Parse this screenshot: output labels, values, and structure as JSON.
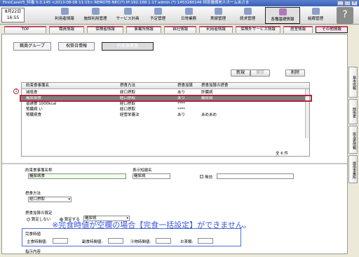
{
  "titlebar": {
    "text": "FirstCareV5_特養 5.0.145 <2013-08-08 11:15> REMOTE-NEC(*) IP:192.168.1.17 admin (*) 1453280146 特別養護老人ホームあさま"
  },
  "datebox": {
    "line1": "8月22日",
    "line2": "16:55"
  },
  "toolbar": {
    "items": [
      {
        "label": "利用者情報",
        "icon": "person-icon"
      },
      {
        "label": "施設利用管理",
        "icon": "building-icon"
      },
      {
        "label": "サービス計画",
        "icon": "plan-icon"
      },
      {
        "label": "予定管理",
        "icon": "calendar-icon"
      },
      {
        "label": "日常業務",
        "icon": "clipboard-icon"
      },
      {
        "label": "実績管理",
        "icon": "chart-icon"
      },
      {
        "label": "請求管理",
        "icon": "invoice-icon"
      },
      {
        "label": "各種基礎情報",
        "icon": "gear-icon",
        "selected": true
      },
      {
        "label": "組織管理",
        "icon": "wrench-icon"
      }
    ],
    "help": "?"
  },
  "tabs": [
    "TOP",
    "職員情報",
    "保険者情報",
    "事業所情報",
    "自社情報",
    "利用者情報",
    "保険外サービス情報",
    "居室情報",
    "その他情報"
  ],
  "side_tabs": [
    "基本情報",
    "関係者",
    "担当者情報",
    "提供事業所"
  ],
  "subtabs": [
    "職員グループ",
    "祝祭日情報",
    "約束食事箋"
  ],
  "buttons": {
    "new": "新規",
    "save": "保存",
    "delete": "削除"
  },
  "table": {
    "headers": [
      "約束食事箋名",
      "摂食方法",
      "摂食加算",
      "摂食加算の摂食"
    ],
    "rows": [
      [
        "減塩食",
        "経口摂取",
        "あり",
        "肝臓病"
      ],
      [
        "糖尿病食",
        "経口摂取",
        "あり",
        "糖尿病"
      ],
      [
        "普通食 1000kcal",
        "経口摂取",
        "****",
        ""
      ],
      [
        "腎臓病 い",
        "経口摂取",
        "****",
        ""
      ],
      [
        "腎臓病食",
        "経管栄養法",
        "あり",
        "あめあめ"
      ]
    ],
    "selected_row": 1,
    "count": "全 6 件"
  },
  "marker": "1",
  "form": {
    "name_label": "約束食事箋名称",
    "name_value": "糖尿病食",
    "short_label": "表示短縮名",
    "short_value": "糖尿病",
    "invalid_label": "無効",
    "method_label": "摂食方法",
    "method_value": "経口摂取",
    "addition_label": "摂食加算の算定",
    "radio_off": "算定しない",
    "radio_on": "算定する",
    "addition_value": "糖尿病",
    "completion_title": "完食時値",
    "main_label": "主食時間値:",
    "side_label": "副食時間値:",
    "soup_label": "汁物時間値:",
    "tea_label": "お茶類:",
    "memo_label": "指示内容"
  },
  "notice": "※完食時値が空欄の場合【完食一括設定】ができません。"
}
